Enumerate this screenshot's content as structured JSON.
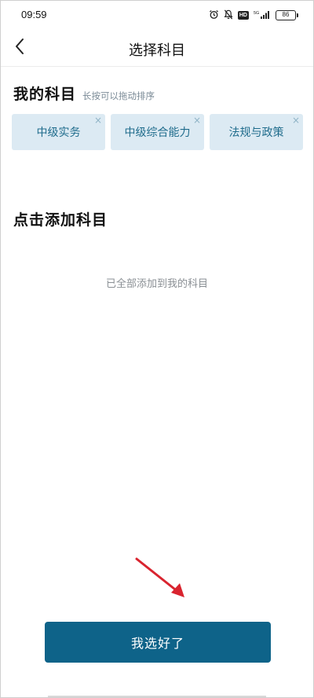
{
  "status_bar": {
    "time": "09:59",
    "battery": "86",
    "icons": [
      "alarm-icon",
      "mute-icon",
      "hd-badge",
      "signal-icon",
      "battery-icon"
    ],
    "hd_label": "HD"
  },
  "header": {
    "title": "选择科目",
    "back_icon": "chevron-left-icon"
  },
  "my_subjects": {
    "title": "我的科目",
    "hint": "长按可以拖动排序",
    "items": [
      {
        "label": "中级实务"
      },
      {
        "label": "中级综合能力"
      },
      {
        "label": "法规与政策"
      }
    ],
    "remove_icon": "close-icon",
    "remove_glyph": "×"
  },
  "add_subjects": {
    "title": "点击添加科目",
    "empty_text": "已全部添加到我的科目"
  },
  "confirm_button": {
    "label": "我选好了"
  },
  "colors": {
    "accent": "#0e6389",
    "chip_bg": "#dceaf3",
    "chip_text": "#1f6c8c",
    "arrow": "#d9242f"
  }
}
